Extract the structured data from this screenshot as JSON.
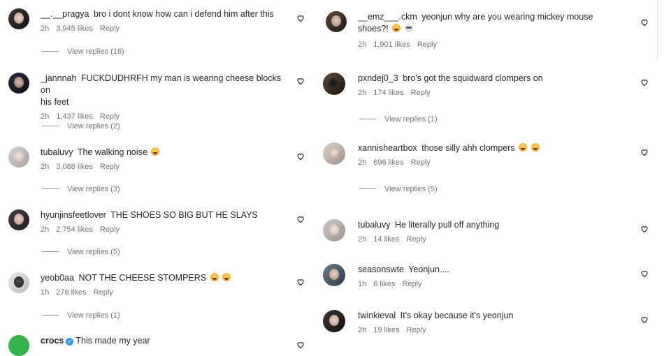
{
  "left": [
    {
      "user": "__.__pragya",
      "text": "bro i dont know how can i defend him after this",
      "time": "2h",
      "likes": "3,945 likes",
      "reply": "Reply",
      "view_replies": "View replies (16)"
    },
    {
      "user": "_jannnah",
      "text": "FUCKDUDHRFH my man is wearing cheese blocks on",
      "text2": "his feet",
      "time": "2h",
      "likes": "1,437 likes",
      "reply": "Reply",
      "view_replies": "View replies (2)"
    },
    {
      "user": "tubaluvy",
      "text": "The walking noise",
      "time": "2h",
      "likes": "3,088 likes",
      "reply": "Reply",
      "view_replies": "View replies (3)"
    },
    {
      "user": "hyunjinsfeetlover",
      "text": "THE SHOES SO BIG BUT HE SLAYS",
      "time": "2h",
      "likes": "2,754 likes",
      "reply": "Reply",
      "view_replies": "View replies (5)"
    },
    {
      "user": "yeob0aa",
      "text": "NOT THE CHEESE STOMPERS",
      "time": "1h",
      "likes": "276 likes",
      "reply": "Reply",
      "view_replies": "View replies (1)"
    },
    {
      "user": "crocs",
      "text": "This made my year"
    }
  ],
  "right": [
    {
      "user": "__emz___.ckm",
      "text": "yeonjun why are you wearing mickey mouse",
      "text2": "shoes?!",
      "time": "2h",
      "likes": "1,901 likes",
      "reply": "Reply"
    },
    {
      "user": "pxndej0_3",
      "text": "bro's got the squidward clompers on",
      "time": "2h",
      "likes": "174 likes",
      "reply": "Reply",
      "view_replies": "View replies (1)"
    },
    {
      "user": "xannisheartbox",
      "text": "those silly ahh clompers",
      "time": "2h",
      "likes": "696 likes",
      "reply": "Reply",
      "view_replies": "View replies (5)"
    },
    {
      "user": "tubaluvy",
      "text": "He literally pull off anything",
      "time": "2h",
      "likes": "14 likes",
      "reply": "Reply"
    },
    {
      "user": "seasonswte",
      "text": "Yeonjun....",
      "time": "1h",
      "likes": "6 likes",
      "reply": "Reply"
    },
    {
      "user": "twinkieval",
      "text": "It's okay because it's yeonjun",
      "time": "2h",
      "likes": "19 likes",
      "reply": "Reply"
    }
  ],
  "icons": {
    "heart": "heart-icon",
    "verified": "verified-badge-icon",
    "emoji_cry": "loudly-crying-face-emoji",
    "emoji_skull": "skull-emoji"
  },
  "colors": {
    "text": "#262626",
    "meta": "#737373",
    "verified": "#3897f0"
  }
}
